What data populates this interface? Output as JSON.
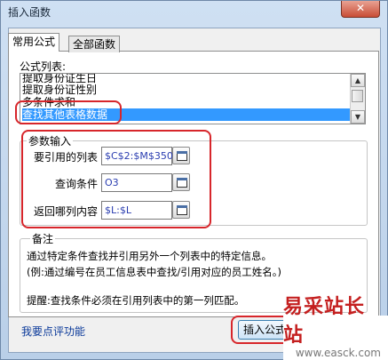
{
  "window": {
    "title": "插入函数",
    "close_symbol": "✕"
  },
  "tabs": [
    {
      "label": "常用公式"
    },
    {
      "label": "全部函数"
    }
  ],
  "formula_list": {
    "label": "公式列表:",
    "items": [
      "提取身份证生日",
      "提取身份证性别",
      "多条件求和",
      "查找其他表格数据"
    ],
    "selected_index": 3
  },
  "params": {
    "group_label": "参数输入",
    "rows": [
      {
        "label": "要引用的列表",
        "value": "$C$2:$M$350"
      },
      {
        "label": "查询条件",
        "value": "O3"
      },
      {
        "label": "返回哪列内容",
        "value": "$L:$L"
      }
    ]
  },
  "notes": {
    "group_label": "备注",
    "line1": "通过特定条件查找并引用另外一个列表中的特定信息。",
    "line2": "(例:通过编号在员工信息表中查找/引用对应的员工姓名。)",
    "line3": "提醒:查找条件必须在引用列表中的第一列匹配。"
  },
  "footer": {
    "feedback_link": "我要点评功能",
    "insert_button": "插入公式"
  },
  "watermark": {
    "logo": "易采站长站",
    "url": "www.easck.com"
  },
  "colors": {
    "annotation_red": "#d7262b",
    "selection_blue": "#3399ff",
    "link_blue": "#0b3a9a"
  }
}
